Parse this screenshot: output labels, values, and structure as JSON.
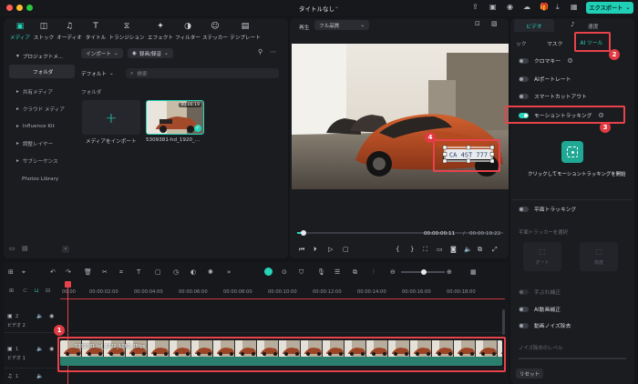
{
  "window": {
    "title": "タイトルなし",
    "export_label": "エクスポート"
  },
  "media_toolbar": [
    {
      "label": "メディア",
      "icon": "media-icon"
    },
    {
      "label": "ストック",
      "icon": "stock-icon"
    },
    {
      "label": "オーディオ",
      "icon": "music-note-icon"
    },
    {
      "label": "タイトル",
      "icon": "title-t-icon"
    },
    {
      "label": "トランジション",
      "icon": "transition-icon"
    },
    {
      "label": "エフェクト",
      "icon": "effect-sparkle-icon"
    },
    {
      "label": "フィルター",
      "icon": "filter-icon"
    },
    {
      "label": "ステッカー",
      "icon": "sticker-icon"
    },
    {
      "label": "テンプレート",
      "icon": "template-icon"
    }
  ],
  "sidebar": {
    "items": [
      {
        "label": "プロジェクトメ..."
      },
      {
        "label": "フォルダ"
      },
      {
        "label": "共有メディア"
      },
      {
        "label": "クラウド メディア"
      },
      {
        "label": "Influence Kit"
      },
      {
        "label": "調整レイヤー"
      },
      {
        "label": "サブシーケンス"
      },
      {
        "label": "Photos Library"
      }
    ]
  },
  "media": {
    "import_label": "インポート",
    "record_label": "録画/録音",
    "sort_label": "デフォルト",
    "search_placeholder": "検索",
    "folder_label": "フォルダ",
    "import_tile_label": "メディアをインポート",
    "clip_name": "5309381-hd_1920_...",
    "clip_duration": "00:00:19"
  },
  "preview": {
    "play_label": "再生",
    "quality_label": "フル品質",
    "current_time": "00:00:00:11",
    "separator": "/",
    "total_time": "00:00:19:22",
    "plate_text": "CA 4ST 777"
  },
  "props": {
    "tabs": [
      "ビデオ",
      "",
      "速度"
    ],
    "subtabs": [
      "ック",
      "マスク",
      "AI ツール"
    ],
    "rows": [
      {
        "label": "クロマキー",
        "on": false
      },
      {
        "label": "AIポートレート",
        "on": false
      },
      {
        "label": "スマートカットアウト",
        "on": false
      },
      {
        "label": "モーショントラッキング",
        "on": true
      }
    ],
    "motion_hint": "クリックしてモーショントラッキングを開始",
    "plane_tracking": "平面トラッキング",
    "plane_select": "平面トラッカーを選択",
    "auto_label": "オート",
    "advanced_label": "高度",
    "ai_rows": [
      "手ぶれ補正",
      "AI動画補正",
      "動画ノイズ除去"
    ],
    "noise_level": "ノイズ除去のレベル",
    "reset_label": "リセット"
  },
  "timeline": {
    "ruler": [
      "00:00",
      "00:00:02:00",
      "00:00:04:00",
      "00:00:06:00",
      "00:00:08:00",
      "00:00:10:00",
      "00:00:12:00",
      "00:00:14:00",
      "00:00:16:00",
      "00:00:18:00"
    ],
    "tracks": [
      {
        "num": "2",
        "name": "ビデオ 2"
      },
      {
        "num": "1",
        "name": "ビデオ 1"
      },
      {
        "num": "1",
        "name": ""
      }
    ],
    "clip_label": "5309381-hd_1920_1080_25fps"
  },
  "annotations": [
    "1",
    "2",
    "3",
    "4"
  ],
  "colors": {
    "accent": "#26d4b8",
    "annotation": "#e8424a",
    "clip": "#2f8f7c"
  }
}
